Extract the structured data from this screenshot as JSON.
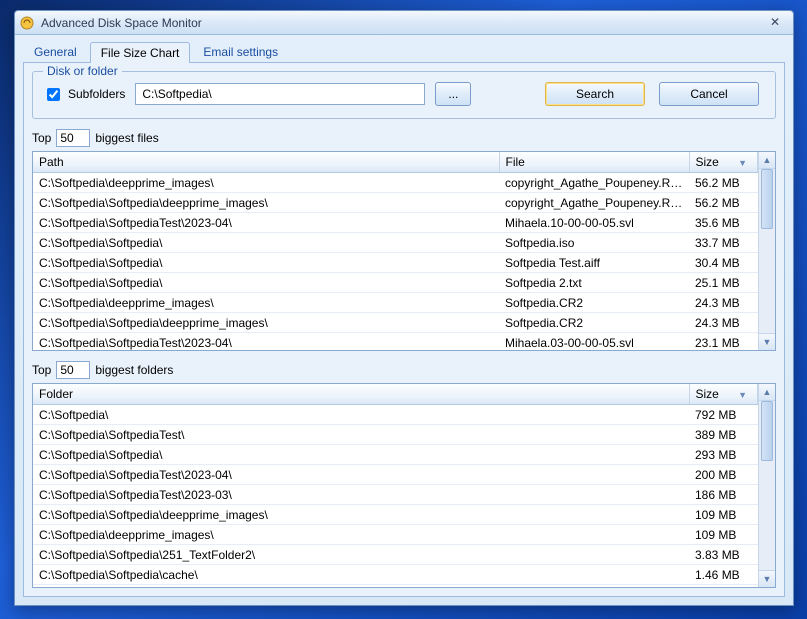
{
  "window": {
    "title": "Advanced Disk Space Monitor"
  },
  "tabs": {
    "general": "General",
    "file_size_chart": "File Size Chart",
    "email_settings": "Email settings"
  },
  "fieldset": {
    "legend": "Disk or folder",
    "subfolders_label": "Subfolders",
    "subfolders_checked": true,
    "path_value": "C:\\Softpedia\\",
    "browse_label": "...",
    "search_label": "Search",
    "cancel_label": "Cancel"
  },
  "files_section": {
    "prefix": "Top",
    "count": "50",
    "suffix": "biggest files",
    "columns": {
      "path": "Path",
      "file": "File",
      "size": "Size"
    },
    "rows": [
      {
        "path": "C:\\Softpedia\\deepprime_images\\",
        "file": "copyright_Agathe_Poupeney.RAF",
        "size": "56.2 MB"
      },
      {
        "path": "C:\\Softpedia\\Softpedia\\deepprime_images\\",
        "file": "copyright_Agathe_Poupeney.RAF",
        "size": "56.2 MB"
      },
      {
        "path": "C:\\Softpedia\\SoftpediaTest\\2023-04\\",
        "file": "Mihaela.10-00-00-05.svl",
        "size": "35.6 MB"
      },
      {
        "path": "C:\\Softpedia\\Softpedia\\",
        "file": "Softpedia.iso",
        "size": "33.7 MB"
      },
      {
        "path": "C:\\Softpedia\\Softpedia\\",
        "file": "Softpedia Test.aiff",
        "size": "30.4 MB"
      },
      {
        "path": "C:\\Softpedia\\Softpedia\\",
        "file": "Softpedia 2.txt",
        "size": "25.1 MB"
      },
      {
        "path": "C:\\Softpedia\\deepprime_images\\",
        "file": "Softpedia.CR2",
        "size": "24.3 MB"
      },
      {
        "path": "C:\\Softpedia\\Softpedia\\deepprime_images\\",
        "file": "Softpedia.CR2",
        "size": "24.3 MB"
      },
      {
        "path": "C:\\Softpedia\\SoftpediaTest\\2023-04\\",
        "file": "Mihaela.03-00-00-05.svl",
        "size": "23.1 MB"
      }
    ]
  },
  "folders_section": {
    "prefix": "Top",
    "count": "50",
    "suffix": "biggest folders",
    "columns": {
      "folder": "Folder",
      "size": "Size"
    },
    "rows": [
      {
        "folder": "C:\\Softpedia\\",
        "size": "792 MB"
      },
      {
        "folder": "C:\\Softpedia\\SoftpediaTest\\",
        "size": "389 MB"
      },
      {
        "folder": "C:\\Softpedia\\Softpedia\\",
        "size": "293 MB"
      },
      {
        "folder": "C:\\Softpedia\\SoftpediaTest\\2023-04\\",
        "size": "200 MB"
      },
      {
        "folder": "C:\\Softpedia\\SoftpediaTest\\2023-03\\",
        "size": "186 MB"
      },
      {
        "folder": "C:\\Softpedia\\Softpedia\\deepprime_images\\",
        "size": "109 MB"
      },
      {
        "folder": "C:\\Softpedia\\deepprime_images\\",
        "size": "109 MB"
      },
      {
        "folder": "C:\\Softpedia\\Softpedia\\251_TextFolder2\\",
        "size": "3.83 MB"
      },
      {
        "folder": "C:\\Softpedia\\Softpedia\\cache\\",
        "size": "1.46 MB"
      }
    ]
  }
}
